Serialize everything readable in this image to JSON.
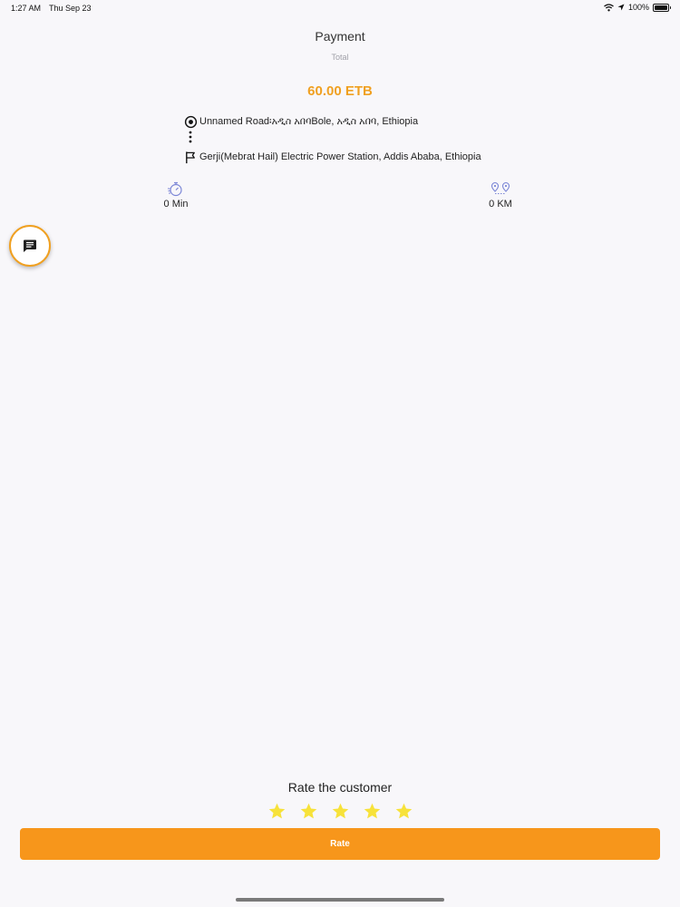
{
  "status_bar": {
    "time": "1:27 AM",
    "date": "Thu Sep 23",
    "battery": "100%"
  },
  "header": {
    "title": "Payment",
    "subtitle": "Total",
    "amount": "60.00 ETB"
  },
  "route": {
    "pickup": "Unnamed Road፡አዲስ አበባBole, አዲስ አበባ, Ethiopia",
    "dropoff": "Gerji(Mebrat Hail) Electric Power Station, Addis Ababa, Ethiopia",
    "pickup_icon": "radio-target-icon",
    "dropoff_icon": "flag-icon"
  },
  "stats": {
    "duration": "0 Min",
    "distance": "0  KM",
    "duration_icon": "stopwatch-icon",
    "distance_icon": "route-pins-icon"
  },
  "chat": {
    "icon": "chat-icon"
  },
  "rating": {
    "title": "Rate the customer",
    "stars": 5,
    "button_label": "Rate"
  },
  "colors": {
    "accent": "#f0a020",
    "button": "#f7961b",
    "star": "#f7e23a",
    "icon_blue": "#7b86d6"
  }
}
